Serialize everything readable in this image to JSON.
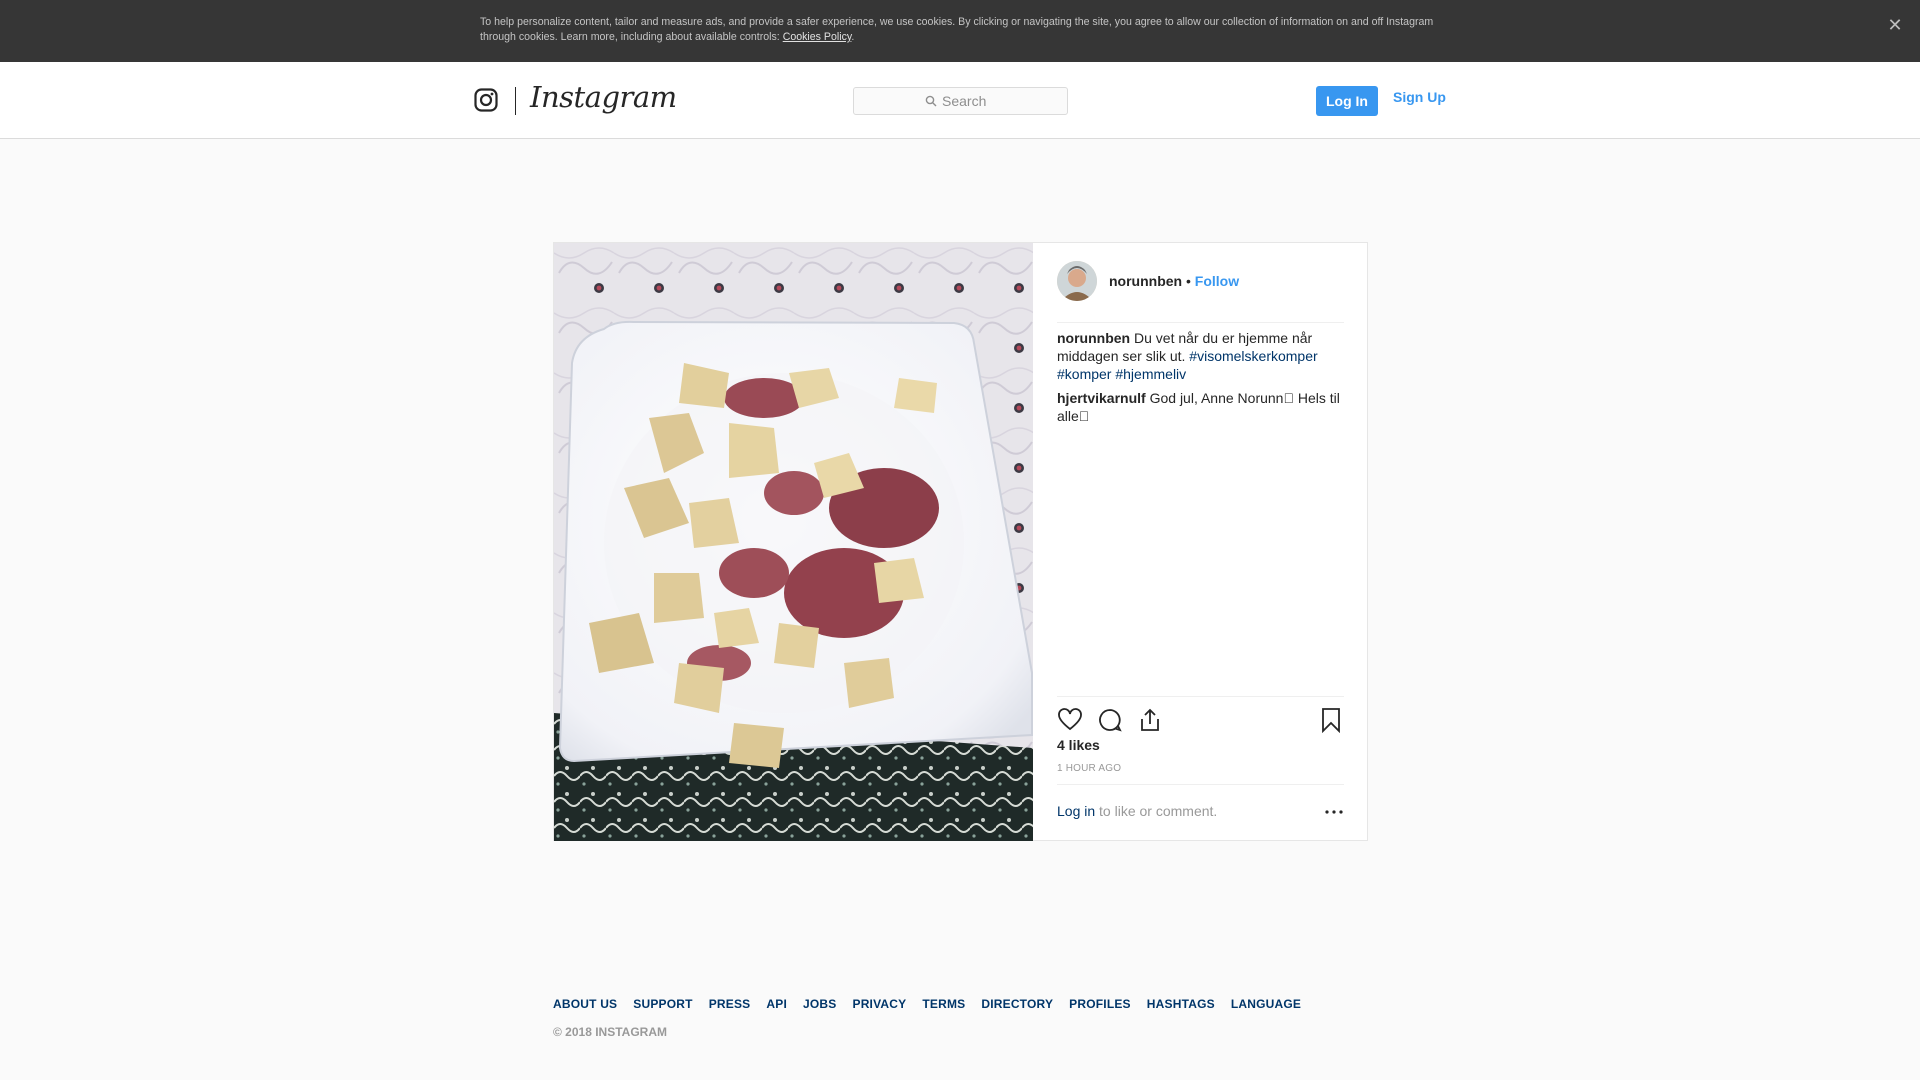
{
  "cookie_banner": {
    "text": "To help personalize content, tailor and measure ads, and provide a safer experience, we use cookies. By clicking or navigating the site, you agree to allow our collection of information on and off Instagram through cookies. Learn more, including about available controls: ",
    "link_label": "Cookies Policy",
    "suffix": ".",
    "close_icon": "close-icon"
  },
  "nav": {
    "brand": "Instagram",
    "search_placeholder": "Search",
    "login_label": "Log In",
    "signup_label": "Sign Up"
  },
  "post": {
    "username": "norunnben",
    "separator": "•",
    "follow_label": "Follow",
    "comments": [
      {
        "user": "norunnben",
        "text": "Du vet når du er hjemme når middagen ser slik ut. ",
        "tags": [
          "#visomelskerkomper",
          "#komper",
          "#hjemmeliv"
        ]
      },
      {
        "user": "hjertvikarnulf",
        "text": "God jul, Anne Norunn\u0000 Hels til alle\u0000",
        "tags": []
      }
    ],
    "actions": [
      "heart-icon",
      "comment-icon",
      "share-icon",
      "bookmark-icon"
    ],
    "likes": "4 likes",
    "time_ago": "1 HOUR AGO",
    "login_link": "Log in",
    "login_suffix": " to like or comment."
  },
  "footer": {
    "links": [
      "ABOUT US",
      "SUPPORT",
      "PRESS",
      "API",
      "JOBS",
      "PRIVACY",
      "TERMS",
      "DIRECTORY",
      "PROFILES",
      "HASHTAGS",
      "LANGUAGE"
    ],
    "copyright": "© 2018 INSTAGRAM"
  },
  "colors": {
    "accent": "#3897f0",
    "link_dark": "#003569",
    "banner_bg": "#363636",
    "page_bg": "#fafafa"
  }
}
